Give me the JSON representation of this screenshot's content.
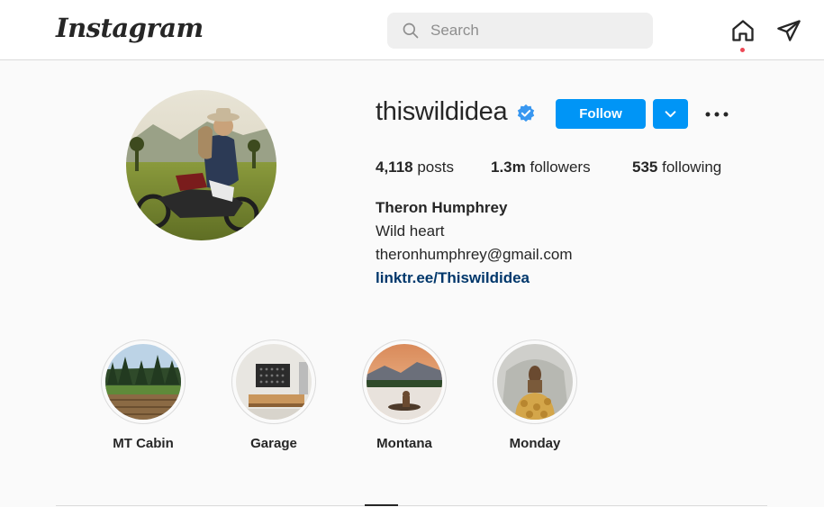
{
  "header": {
    "logo": "Instagram",
    "search_placeholder": "Search",
    "notification_dot_color": "#ed4956"
  },
  "profile": {
    "username": "thiswildidea",
    "verified": true,
    "follow_label": "Follow",
    "accent_color": "#0095f6",
    "stats": {
      "posts_count": "4,118",
      "posts_label": "posts",
      "followers_count": "1.3m",
      "followers_label": "followers",
      "following_count": "535",
      "following_label": "following"
    },
    "full_name": "Theron Humphrey",
    "bio_lines": [
      "Wild heart",
      "theronhumphrey@gmail.com"
    ],
    "link": "linktr.ee/Thiswildidea"
  },
  "highlights": [
    {
      "label": "MT Cabin"
    },
    {
      "label": "Garage"
    },
    {
      "label": "Montana"
    },
    {
      "label": "Monday"
    }
  ],
  "icons": {
    "search": "search-icon",
    "home": "home-icon",
    "direct": "paper-plane-icon",
    "verified": "verified-badge-icon",
    "dropdown": "chevron-down-icon",
    "more": "more-options-icon"
  }
}
